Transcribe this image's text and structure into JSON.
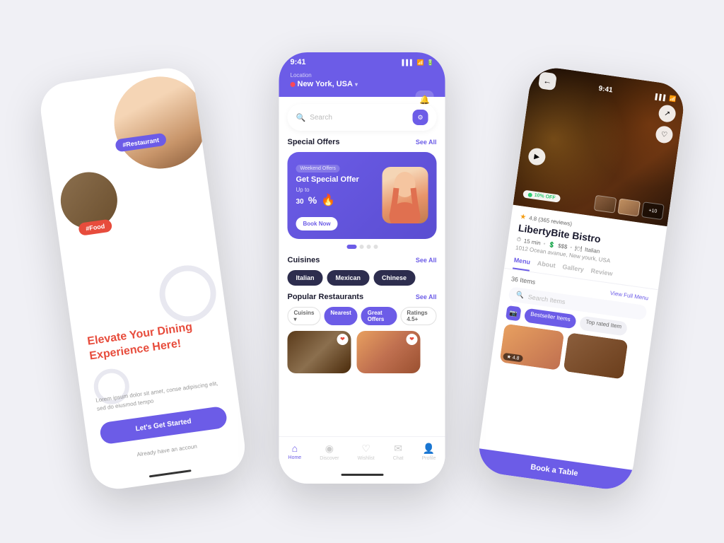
{
  "scene": {
    "background": "#f0f0f5"
  },
  "phone_left": {
    "tag1": "#Restaurant",
    "tag2": "#Food",
    "headline_line1": "Elevate Your Dining",
    "headline_line2": "Experience Here!",
    "subtitle": "Lorem ipsum dolor sit amet, conse adipiscing elit, sed do eiusmod tempo",
    "btn_label": "Let's Get Started",
    "account_text": "Already have an accoun"
  },
  "phone_center": {
    "status_time": "9:41",
    "location_label": "Location",
    "location_value": "New York, USA",
    "search_placeholder": "Search",
    "special_offers_title": "Special Offers",
    "special_offers_see_all": "See All",
    "offer_badge": "Weekend Offers",
    "offer_title": "Get Special Offer",
    "offer_up_to": "Up to",
    "offer_percent": "30",
    "btn_book": "Book Now",
    "cuisines_title": "Cuisines",
    "cuisines_see_all": "See All",
    "cuisines": [
      "Italian",
      "Mexican",
      "Chinese"
    ],
    "popular_title": "Popular Restaurants",
    "popular_see_all": "See All",
    "filter_chips": [
      "Cuisins ▾",
      "Nearest",
      "Great Offers",
      "Ratings 4.5+"
    ],
    "nav_items": [
      {
        "label": "Home",
        "icon": "⌂",
        "active": true
      },
      {
        "label": "Discover",
        "icon": "◉",
        "active": false
      },
      {
        "label": "Wishlist",
        "icon": "♡",
        "active": false
      },
      {
        "label": "Chat",
        "icon": "✉",
        "active": false
      },
      {
        "label": "Profile",
        "icon": "👤",
        "active": false
      }
    ]
  },
  "phone_right": {
    "status_time": "9:41",
    "discount": "10% OFF",
    "rating": "4.8",
    "review_count": "365 reviews",
    "restaurant_name": "LibertyBite Bistro",
    "delivery_time": "15 min",
    "price_range": "$$$",
    "cuisine_type": "Italian",
    "address": "1012 Ocean avanue, New yourk, USA",
    "tabs": [
      "Menu",
      "About",
      "Gallery",
      "Review"
    ],
    "active_tab": "Menu",
    "menu_count": "36 Items",
    "view_full": "View Full Menu",
    "search_items_placeholder": "Search Items",
    "filter_tabs": [
      "Bestseller Items",
      "Top rated Item"
    ],
    "food_rating": "4.8",
    "book_btn": "Book a Table"
  }
}
